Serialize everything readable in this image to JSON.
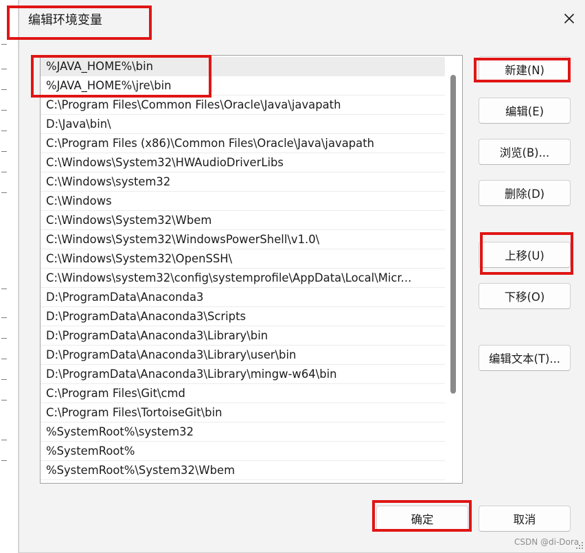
{
  "dialog": {
    "title": "编辑环境变量",
    "close_icon": "close-icon"
  },
  "path_list": {
    "items": [
      "%JAVA_HOME%\\bin",
      "%JAVA_HOME%\\jre\\bin",
      "C:\\Program Files\\Common Files\\Oracle\\Java\\javapath",
      "D:\\Java\\bin\\",
      "C:\\Program Files (x86)\\Common Files\\Oracle\\Java\\javapath",
      "C:\\Windows\\System32\\HWAudioDriverLibs",
      "C:\\Windows\\system32",
      "C:\\Windows",
      "C:\\Windows\\System32\\Wbem",
      "C:\\Windows\\System32\\WindowsPowerShell\\v1.0\\",
      "C:\\Windows\\System32\\OpenSSH\\",
      "C:\\Windows\\system32\\config\\systemprofile\\AppData\\Local\\Micr...",
      "D:\\ProgramData\\Anaconda3",
      "D:\\ProgramData\\Anaconda3\\Scripts",
      "D:\\ProgramData\\Anaconda3\\Library\\bin",
      "D:\\ProgramData\\Anaconda3\\Library\\user\\bin",
      "D:\\ProgramData\\Anaconda3\\Library\\mingw-w64\\bin",
      "C:\\Program Files\\Git\\cmd",
      "C:\\Program Files\\TortoiseGit\\bin",
      "%SystemRoot%\\system32",
      "%SystemRoot%",
      "%SystemRoot%\\System32\\Wbem"
    ],
    "selected_index": 0
  },
  "buttons": {
    "new": "新建(N)",
    "edit": "编辑(E)",
    "browse": "浏览(B)...",
    "delete": "删除(D)",
    "move_up": "上移(U)",
    "move_down": "下移(O)",
    "edit_text": "编辑文本(T)...",
    "ok": "确定",
    "cancel": "取消"
  },
  "watermark": "CSDN @di-Dora",
  "colors": {
    "annotation": "#e01515",
    "dialog_bg": "#f3f3f3"
  }
}
